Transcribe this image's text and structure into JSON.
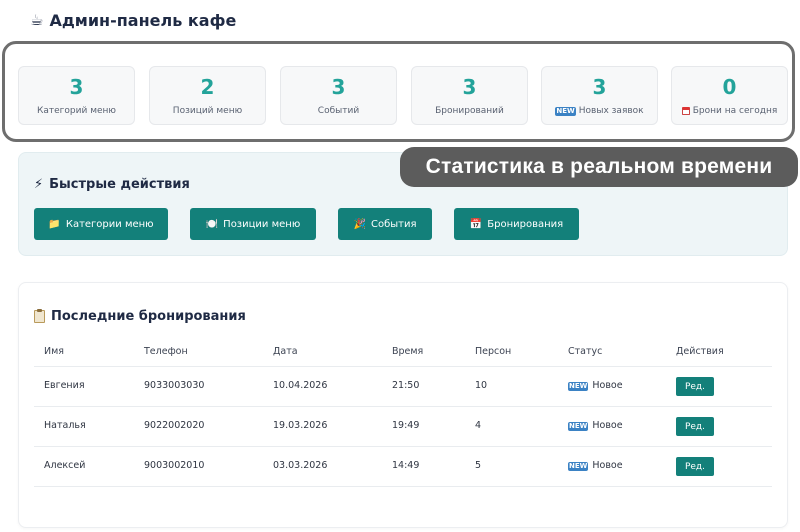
{
  "header": {
    "title": "Админ-панель кафе",
    "icon": "coffee-icon",
    "emoji": "☕"
  },
  "stats": [
    {
      "value": "3",
      "label": "Категорий меню"
    },
    {
      "value": "2",
      "label": "Позиций меню"
    },
    {
      "value": "3",
      "label": "Событий"
    },
    {
      "value": "3",
      "label": "Бронирований"
    },
    {
      "value": "3",
      "label": "Новых заявок",
      "icon": "new-badge-icon",
      "icon_text": "NEW"
    },
    {
      "value": "0",
      "label": "Брони на сегодня",
      "icon": "calendar-icon"
    }
  ],
  "overlay": {
    "label": "Статистика в реальном времени"
  },
  "quick_actions": {
    "title": "Быстрые действия",
    "title_emoji": "⚡",
    "buttons": [
      {
        "label": "Категории меню",
        "emoji": "📁"
      },
      {
        "label": "Позиции меню",
        "emoji": "🍽️"
      },
      {
        "label": "События",
        "emoji": "🎉"
      },
      {
        "label": "Бронирования",
        "emoji": "📅"
      }
    ]
  },
  "bookings": {
    "title": "Последние бронирования",
    "columns": [
      "Имя",
      "Телефон",
      "Дата",
      "Время",
      "Персон",
      "Статус",
      "Действия"
    ],
    "rows": [
      {
        "name": "Евгения",
        "phone": "9033003030",
        "date": "10.04.2026",
        "time": "21:50",
        "persons": "10",
        "status": "Новое",
        "action": "Ред."
      },
      {
        "name": "Наталья",
        "phone": "9022002020",
        "date": "19.03.2026",
        "time": "19:49",
        "persons": "4",
        "status": "Новое",
        "action": "Ред."
      },
      {
        "name": "Алексей",
        "phone": "9003002010",
        "date": "03.03.2026",
        "time": "14:49",
        "persons": "5",
        "status": "Новое",
        "action": "Ред."
      }
    ],
    "status_icon_text": "NEW"
  },
  "colors": {
    "accent": "#13807a",
    "stat_number": "#23a39a",
    "overlay_bg": "#5c5c5c"
  }
}
